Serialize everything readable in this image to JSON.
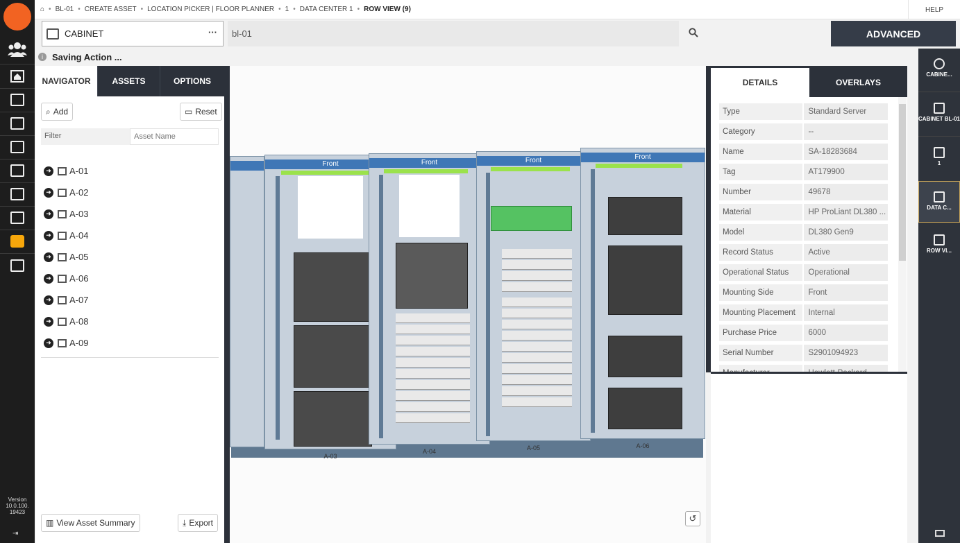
{
  "app": {
    "logo_text": "",
    "version": "Version 10.0.100. 19423"
  },
  "breadcrumb": {
    "items": [
      "BL-01",
      "CREATE ASSET",
      "LOCATION PICKER | FLOOR PLANNER",
      "1",
      "DATA CENTER 1"
    ],
    "current": "ROW VIEW (9)",
    "help": "HELP"
  },
  "search": {
    "asset_type": "CABINET",
    "query": "bl-01",
    "advanced_label": "ADVANCED"
  },
  "status": {
    "message": "Saving Action ..."
  },
  "navigator": {
    "tabs": [
      "NAVIGATOR",
      "ASSETS",
      "OPTIONS"
    ],
    "add_label": "Add",
    "reset_label": "Reset",
    "filter_label": "Filter",
    "filter_placeholder": "Asset Name",
    "items": [
      "A-01",
      "A-02",
      "A-03",
      "A-04",
      "A-05",
      "A-06",
      "A-07",
      "A-08",
      "A-09"
    ],
    "view_summary_label": "View Asset Summary",
    "export_label": "Export"
  },
  "viewport": {
    "cabinets": [
      {
        "front": "",
        "name": ""
      },
      {
        "front": "Front",
        "name": "A-03"
      },
      {
        "front": "Front",
        "name": "A-04"
      },
      {
        "front": "Front",
        "name": "A-05"
      },
      {
        "front": "Front",
        "name": "A-06"
      }
    ]
  },
  "details": {
    "tabs": [
      "DETAILS",
      "OVERLAYS"
    ],
    "rows": [
      {
        "k": "Type",
        "v": "Standard Server"
      },
      {
        "k": "Category",
        "v": "--"
      },
      {
        "k": "Name",
        "v": "SA-18283684"
      },
      {
        "k": "Tag",
        "v": "AT179900"
      },
      {
        "k": "Number",
        "v": "49678"
      },
      {
        "k": "Material",
        "v": "HP ProLiant DL380 ..."
      },
      {
        "k": "Model",
        "v": "DL380 Gen9"
      },
      {
        "k": "Record Status",
        "v": "Active"
      },
      {
        "k": "Operational Status",
        "v": "Operational"
      },
      {
        "k": "Mounting Side",
        "v": "Front"
      },
      {
        "k": "Mounting Placement",
        "v": "Internal"
      },
      {
        "k": "Purchase Price",
        "v": "6000"
      },
      {
        "k": "Serial Number",
        "v": "S2901094923"
      },
      {
        "k": "Manufacturer",
        "v": "Hewlett-Packard"
      }
    ]
  },
  "rightrail": {
    "items": [
      "CABINE...",
      "CABINET BL-01",
      "1",
      "DATA C...",
      "ROW VI..."
    ]
  },
  "colors": {
    "accent": "#f26322",
    "dark_panel": "#2c313a",
    "button": "#353c48",
    "active_outline": "#c7a458"
  }
}
